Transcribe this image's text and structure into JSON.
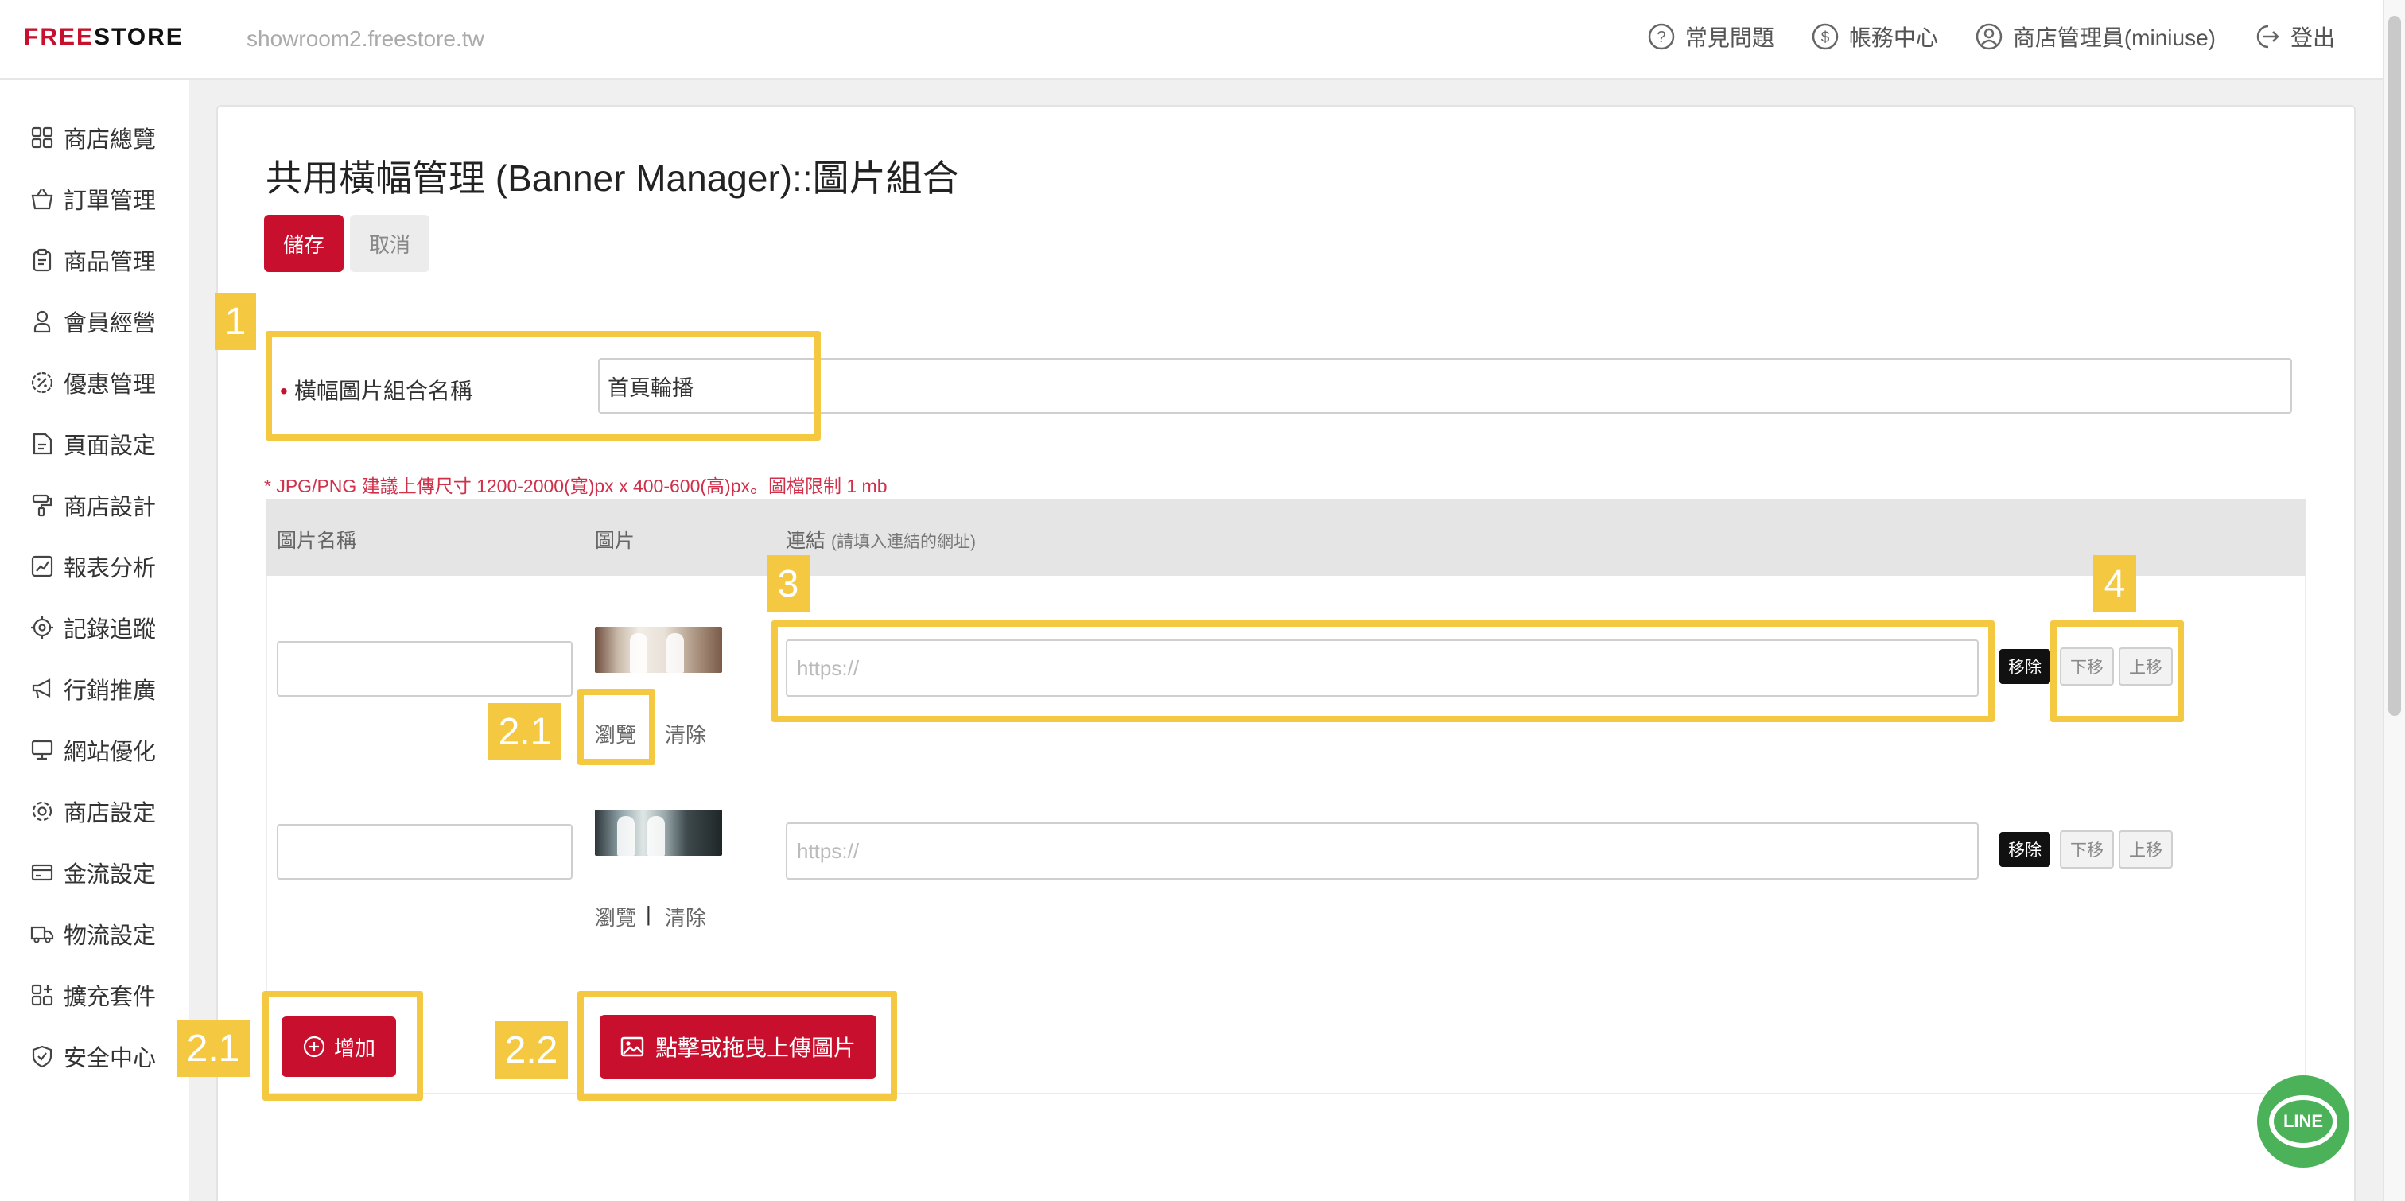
{
  "header": {
    "logo_free": "FREE",
    "logo_store": "STORE",
    "domain": "showroom2.freestore.tw",
    "nav": [
      {
        "label": "常見問題",
        "icon": "question-circle-icon"
      },
      {
        "label": "帳務中心",
        "icon": "dollar-circle-icon"
      },
      {
        "label": "商店管理員(miniuse)",
        "icon": "user-circle-icon"
      },
      {
        "label": "登出",
        "icon": "logout-icon"
      }
    ]
  },
  "sidebar": {
    "items": [
      {
        "label": "商店總覽",
        "icon": "grid-icon"
      },
      {
        "label": "訂單管理",
        "icon": "basket-icon"
      },
      {
        "label": "商品管理",
        "icon": "clipboard-icon"
      },
      {
        "label": "會員經營",
        "icon": "user-icon"
      },
      {
        "label": "優惠管理",
        "icon": "discount-badge-icon"
      },
      {
        "label": "頁面設定",
        "icon": "page-icon"
      },
      {
        "label": "商店設計",
        "icon": "paint-roller-icon"
      },
      {
        "label": "報表分析",
        "icon": "chart-icon"
      },
      {
        "label": "記錄追蹤",
        "icon": "target-icon"
      },
      {
        "label": "行銷推廣",
        "icon": "megaphone-icon"
      },
      {
        "label": "網站優化",
        "icon": "monitor-icon"
      },
      {
        "label": "商店設定",
        "icon": "gear-icon"
      },
      {
        "label": "金流設定",
        "icon": "credit-card-icon"
      },
      {
        "label": "物流設定",
        "icon": "truck-icon"
      },
      {
        "label": "擴充套件",
        "icon": "plugin-icon"
      },
      {
        "label": "安全中心",
        "icon": "shield-icon"
      }
    ]
  },
  "page": {
    "title": "共用橫幅管理 (Banner Manager)::圖片組合",
    "save_label": "儲存",
    "cancel_label": "取消",
    "name_label": "橫幅圖片組合名稱",
    "name_value": "首頁輪播",
    "hint": "* JPG/PNG 建議上傳尺寸 1200-2000(寬)px x 400-600(高)px。圖檔限制 1 mb"
  },
  "table": {
    "col_name": "圖片名稱",
    "col_image": "圖片",
    "col_link": "連結",
    "col_link_note": "(請填入連結的網址)",
    "rows": [
      {
        "name_value": "",
        "url_placeholder": "https://",
        "browse": "瀏覽",
        "clear": "清除",
        "remove": "移除",
        "down": "下移",
        "up": "上移"
      },
      {
        "name_value": "",
        "url_placeholder": "https://",
        "browse": "瀏覽",
        "separator": "|",
        "clear": "清除",
        "remove": "移除",
        "down": "下移",
        "up": "上移"
      }
    ],
    "add_label": "增加",
    "upload_label": "點擊或拖曳上傳圖片"
  },
  "annotations": {
    "tag1": "1",
    "tag21a": "2.1",
    "tag3": "3",
    "tag4": "4",
    "tag21b": "2.1",
    "tag22": "2.2"
  },
  "line_button": "LINE",
  "colors": {
    "brand_red": "#c8102e",
    "annotation_yellow": "#f5c842",
    "line_green": "#4cb25a"
  }
}
